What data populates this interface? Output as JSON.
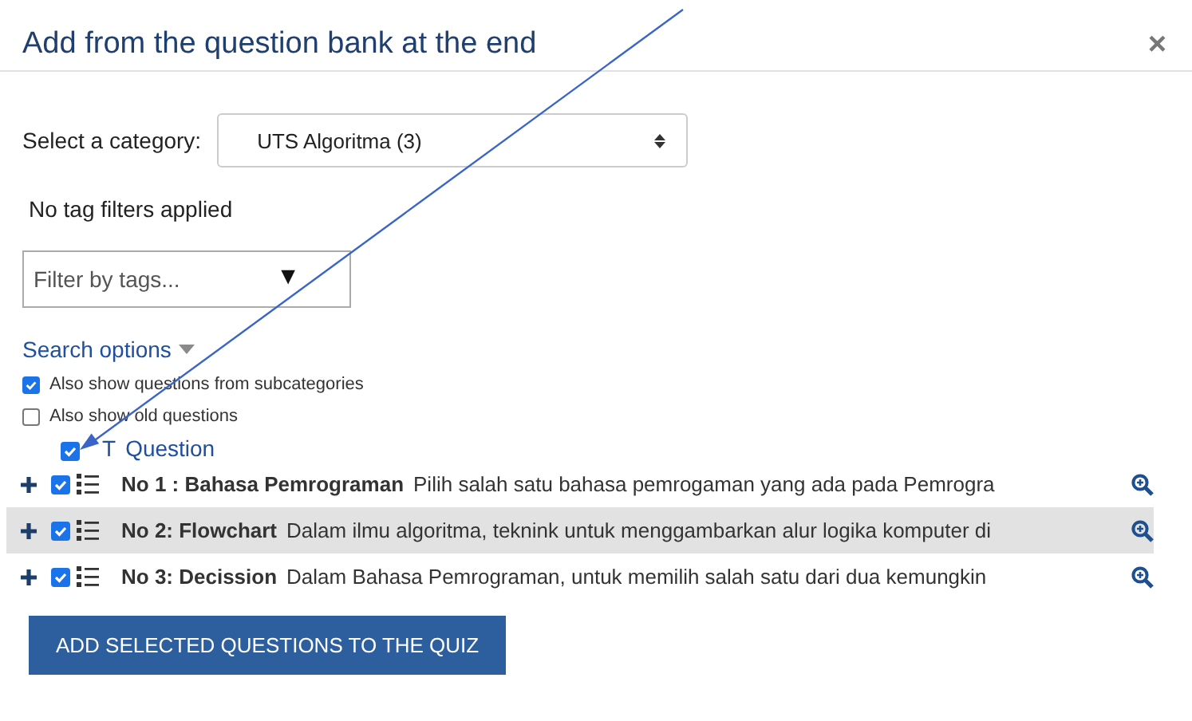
{
  "dialog": {
    "title": "Add from the question bank at the end",
    "close": "×"
  },
  "category": {
    "label": "Select a category:",
    "value": "UTS Algoritma (3)"
  },
  "tag_status": "No tag filters applied",
  "tag_filter": {
    "placeholder": "Filter by tags...",
    "caret": "▼"
  },
  "search_options": {
    "label": "Search options",
    "expanded": false,
    "options": [
      {
        "label": "Also show questions from subcategories",
        "checked": true
      },
      {
        "label": "Also show old questions",
        "checked": false
      }
    ]
  },
  "table": {
    "select_all": true,
    "columns": [
      "T",
      "Question"
    ],
    "rows": [
      {
        "checked": true,
        "highlighted": false,
        "name": "No 1 : Bahasa Pemrograman",
        "text": "Pilih salah satu bahasa pemrogaman yang ada pada Pemrogra"
      },
      {
        "checked": true,
        "highlighted": true,
        "name": "No 2: Flowchart",
        "text": "Dalam ilmu algoritma, teknink untuk menggambarkan alur logika komputer di"
      },
      {
        "checked": true,
        "highlighted": false,
        "name": "No 3: Decission",
        "text": "Dalam Bahasa Pemrograman, untuk memilih salah satu dari dua kemungkin"
      }
    ]
  },
  "submit": "ADD SELECTED QUESTIONS TO THE QUIZ"
}
